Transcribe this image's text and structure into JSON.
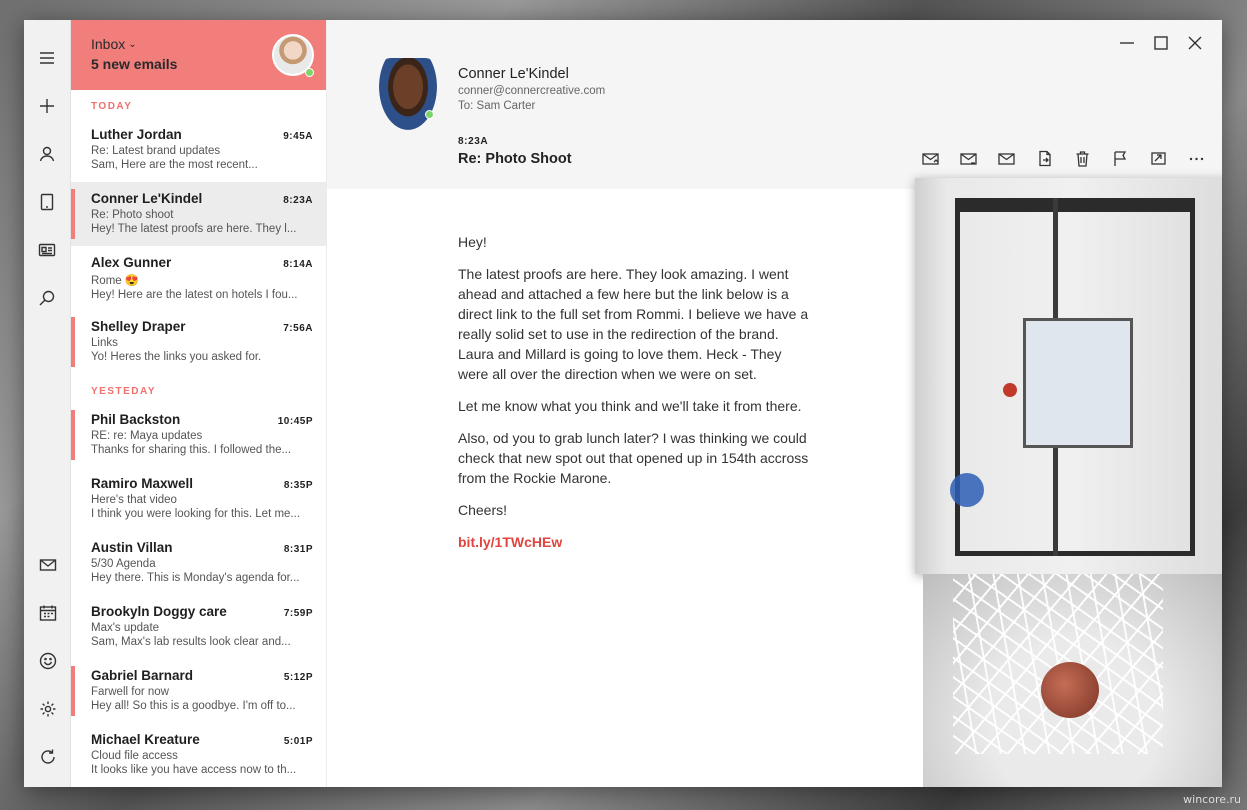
{
  "list": {
    "folder": "Inbox",
    "new_count": "5 new emails",
    "sections": {
      "today": "TODAY",
      "yesterday": "YESTEDAY"
    },
    "today": [
      {
        "sender": "Luther Jordan",
        "time": "9:45A",
        "subject": "Re: Latest brand updates",
        "preview": "Sam, Here are the most recent...",
        "flagged": false,
        "selected": false
      },
      {
        "sender": "Conner Le'Kindel",
        "time": "8:23A",
        "subject": "Re: Photo shoot",
        "preview": "Hey! The latest proofs are here. They l...",
        "flagged": true,
        "selected": true
      },
      {
        "sender": "Alex Gunner",
        "time": "8:14A",
        "subject": "Rome 😍",
        "preview": "Hey! Here are the latest on hotels I fou...",
        "flagged": false,
        "selected": false
      },
      {
        "sender": "Shelley Draper",
        "time": "7:56A",
        "subject": "Links",
        "preview": "Yo! Heres the links you asked for.",
        "flagged": true,
        "selected": false
      }
    ],
    "yesterday": [
      {
        "sender": "Phil Backston",
        "time": "10:45P",
        "subject": "RE: re: Maya updates",
        "preview": "Thanks for sharing this. I followed the...",
        "flagged": true,
        "selected": false
      },
      {
        "sender": "Ramiro Maxwell",
        "time": "8:35P",
        "subject": "Here's that video",
        "preview": "I think you were looking for this. Let me...",
        "flagged": false,
        "selected": false
      },
      {
        "sender": "Austin Villan",
        "time": "8:31P",
        "subject": "5/30 Agenda",
        "preview": "Hey there. This is Monday's agenda for...",
        "flagged": false,
        "selected": false
      },
      {
        "sender": "Brookyln Doggy care",
        "time": "7:59P",
        "subject": "Max's update",
        "preview": "Sam, Max's lab results look clear and...",
        "flagged": false,
        "selected": false
      },
      {
        "sender": "Gabriel Barnard",
        "time": "5:12P",
        "subject": "Farwell for now",
        "preview": "Hey all! So this is a goodbye. I'm off to...",
        "flagged": true,
        "selected": false
      },
      {
        "sender": "Michael Kreature",
        "time": "5:01P",
        "subject": "Cloud file access",
        "preview": "It looks like you have access now to th...",
        "flagged": false,
        "selected": false
      }
    ]
  },
  "message": {
    "from_name": "Conner Le'Kindel",
    "from_email": "conner@connercreative.com",
    "to": "To: Sam Carter",
    "time": "8:23A",
    "subject": "Re: Photo Shoot",
    "paragraphs": [
      "Hey!",
      "The latest proofs are here. They look amazing. I went ahead and attached a few here but the link below is a direct link to the full set from Rommi. I believe we have a really solid set to use in the redirection of the brand. Laura and Millard is going to love them. Heck - They were all over the direction when we were on set.",
      "Let me know what you think and we'll take it from there.",
      "Also, od you to grab lunch later? I was thinking we could check that new spot out that opened up in 154th accross from the Rockie Marone.",
      "Cheers!"
    ],
    "link": "bit.ly/1TWcHEw"
  },
  "watermark": "wincore.ru",
  "colors": {
    "accent": "#f27e7c",
    "link": "#e0453f",
    "online": "#7fd36b"
  },
  "icons": {
    "rail_top": [
      "menu-icon",
      "plus-icon",
      "person-icon",
      "tablet-icon",
      "news-icon",
      "search-icon"
    ],
    "rail_bottom": [
      "mail-icon",
      "calendar-icon",
      "smiley-icon",
      "gear-icon",
      "refresh-icon"
    ],
    "toolbar": [
      "reply-icon",
      "reply-all-icon",
      "forward-icon",
      "archive-icon",
      "trash-icon",
      "flag-icon",
      "move-icon",
      "more-icon"
    ]
  }
}
